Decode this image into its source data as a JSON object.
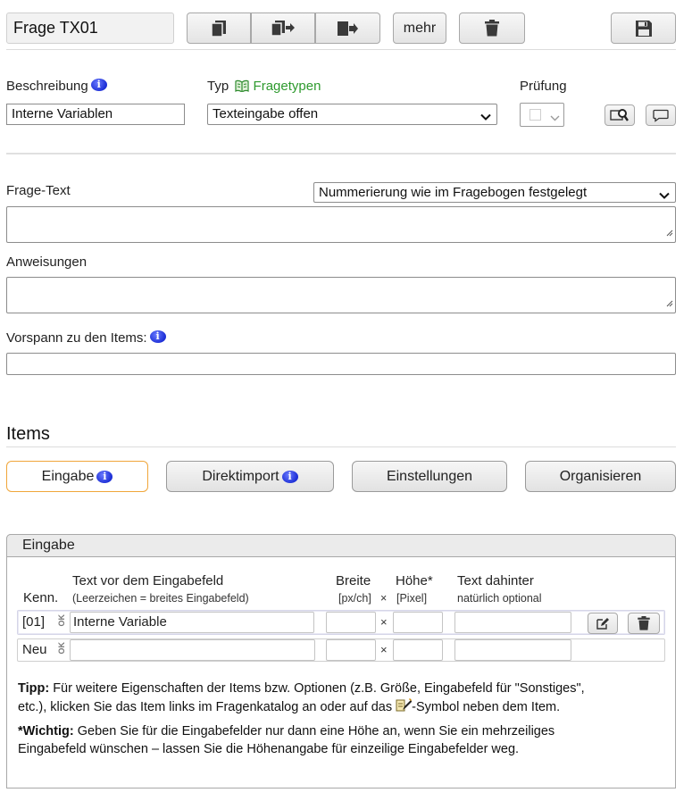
{
  "toolbar": {
    "question_id": "Frage TX01",
    "more_label": "mehr",
    "copy_icon": "copy-icon",
    "copy_to_icon": "copy-to-icon",
    "move_icon": "move-icon",
    "delete_icon": "trash-icon",
    "save_icon": "save-icon"
  },
  "meta": {
    "description_label": "Beschreibung",
    "description_value": "Interne Variablen",
    "type_label": "Typ",
    "types_link": "Fragetypen",
    "type_value": "Texteingabe offen",
    "check_label": "Prüfung"
  },
  "question": {
    "text_label": "Frage-Text",
    "numbering_value": "Nummerierung wie im Fragebogen festgelegt",
    "instructions_label": "Anweisungen",
    "intro_label": "Vorspann zu den Items:"
  },
  "items": {
    "heading": "Items",
    "tabs": [
      "Eingabe",
      "Direktimport",
      "Einstellungen",
      "Organisieren"
    ],
    "panel_title": "Eingabe",
    "columns": {
      "id": "Kenn.",
      "text_before": "Text vor dem Eingabefeld",
      "text_before_hint": "(Leerzeichen = breites Eingabefeld)",
      "width": "Breite",
      "width_unit": "[px/ch]",
      "times": "×",
      "height": "Höhe*",
      "height_unit": "[Pixel]",
      "text_after": "Text dahinter",
      "text_after_hint": "natürlich optional"
    },
    "rows": [
      {
        "id": "[01]",
        "handle": "OK",
        "text_before": "Interne Variable",
        "width": "",
        "height": "",
        "text_after": ""
      },
      {
        "id": "Neu",
        "handle": "OK",
        "text_before": "",
        "width": "",
        "height": "",
        "text_after": ""
      }
    ],
    "tip_bold": "Tipp:",
    "tip_text_1": " Für weitere Eigenschaften der Items bzw. Optionen (z.B. Größe, Eingabefeld für \"Sonstiges\",",
    "tip_text_2a": "etc.), klicken Sie das Item links im Fragenkatalog an oder auf das ",
    "tip_text_2b": "-Symbol neben dem Item.",
    "important_bold": "*Wichtig:",
    "important_text_1": " Geben Sie für die Eingabefelder nur dann eine Höhe an, wenn Sie ein mehrzeiliges",
    "important_text_2": "Eingabefeld wünschen – lassen Sie die Höhenangabe für einzeilige Eingabefelder weg."
  }
}
